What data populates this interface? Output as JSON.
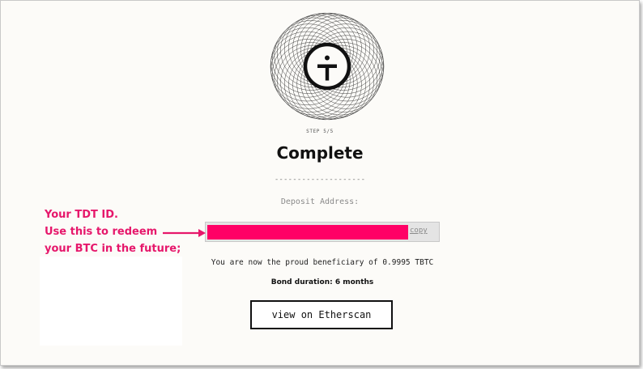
{
  "step": {
    "label": "STEP 5/5"
  },
  "page": {
    "title": "Complete",
    "divider": "--------------------"
  },
  "deposit": {
    "label": "Deposit Address:",
    "copy_label": "copy"
  },
  "result": {
    "beneficiary_text": "You are now the proud beneficiary of 0.9995 TBTC",
    "bond_duration": "Bond duration: 6 months"
  },
  "actions": {
    "etherscan_label": "view on Etherscan"
  },
  "annotation": {
    "lines": [
      "Your TDT ID.",
      "Use this to redeem",
      "your BTC in the future;"
    ]
  },
  "colors": {
    "accent": "#e6176b",
    "redaction": "#ff0066",
    "background": "#fcfbf8"
  },
  "icons": {
    "logo": "tbtc-t-logo-icon"
  }
}
